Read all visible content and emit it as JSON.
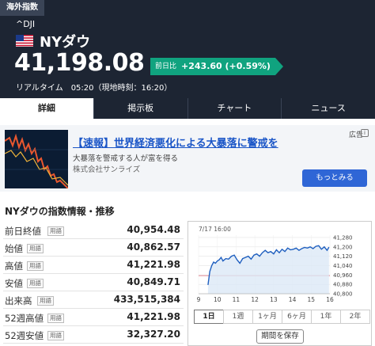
{
  "header": {
    "badge": "海外指数",
    "ticker": "^DJI",
    "name": "NYダウ",
    "price": "41,198.08",
    "realtime": "リアルタイム　05:20（現地時刻：16:20）",
    "change_label": "前日比",
    "change_value": "+243.60 (+0.59%)",
    "accent": "#10a37f",
    "background": "#1d2533"
  },
  "tabs": [
    {
      "label": "詳細"
    },
    {
      "label": "掲示板"
    },
    {
      "label": "チャート"
    },
    {
      "label": "ニュース"
    }
  ],
  "ad": {
    "title": "【速報】世界経済悪化による大暴落に警戒を",
    "desc": "大暴落を警戒する人が富を得る",
    "company": "株式会社サンライズ",
    "label": "広告",
    "button": "もっとみる"
  },
  "section": {
    "title": "NYダウの指数情報・推移",
    "rows": [
      {
        "label": "前日終値",
        "tag": "用語",
        "value": "40,954.48"
      },
      {
        "label": "始値",
        "tag": "用語",
        "value": "40,862.57"
      },
      {
        "label": "高値",
        "tag": "用語",
        "value": "41,221.98"
      },
      {
        "label": "安値",
        "tag": "用語",
        "value": "40,849.71"
      },
      {
        "label": "出来高",
        "tag": "用語",
        "value": "433,515,384"
      },
      {
        "label": "52週高値",
        "tag": "用語",
        "value": "41,221.98"
      },
      {
        "label": "52週安値",
        "tag": "用語",
        "value": "32,327.20"
      }
    ]
  },
  "chart": {
    "timestamp": "7/17 16:00",
    "periods": [
      "1日",
      "1週",
      "1ヶ月",
      "6ヶ月",
      "1年",
      "2年"
    ],
    "active_period": "1日",
    "save_label": "期間を保存"
  },
  "chart_data": {
    "type": "line",
    "x_ticks": [
      "9",
      "10",
      "11",
      "12",
      "13",
      "14",
      "15",
      "16"
    ],
    "y_ticks": [
      "41,280",
      "41,200",
      "41,120",
      "41,040",
      "40,960",
      "40,880",
      "40,800"
    ],
    "ylim": [
      40800,
      41300
    ],
    "xlim": [
      9.5,
      16.0
    ],
    "prev_close": 40954.48,
    "series": [
      {
        "x": [
          9.5,
          9.55,
          9.6,
          9.7,
          9.8,
          9.9,
          10.0,
          10.1,
          10.2,
          10.3,
          10.45,
          10.6,
          10.75,
          10.9,
          11.05,
          11.2,
          11.35,
          11.5,
          11.65,
          11.8,
          11.95,
          12.1,
          12.25,
          12.4,
          12.55,
          12.7,
          12.85,
          13.0,
          13.15,
          13.3,
          13.45,
          13.6,
          13.75,
          13.9,
          14.05,
          14.2,
          14.35,
          14.5,
          14.65,
          14.8,
          14.95,
          15.1,
          15.25,
          15.4,
          15.55,
          15.7,
          15.85,
          15.95
        ],
        "y": [
          40875,
          40930,
          40990,
          41040,
          41070,
          41060,
          41080,
          41090,
          41110,
          41080,
          41100,
          41095,
          41120,
          41130,
          41090,
          41060,
          41100,
          41110,
          41120,
          41095,
          41130,
          41140,
          41120,
          41150,
          41170,
          41150,
          41160,
          41140,
          41175,
          41150,
          41180,
          41160,
          41190,
          41175,
          41180,
          41190,
          41170,
          41185,
          41195,
          41190,
          41200,
          41185,
          41205,
          41210,
          41180,
          41200,
          41170,
          41198
        ]
      }
    ]
  }
}
